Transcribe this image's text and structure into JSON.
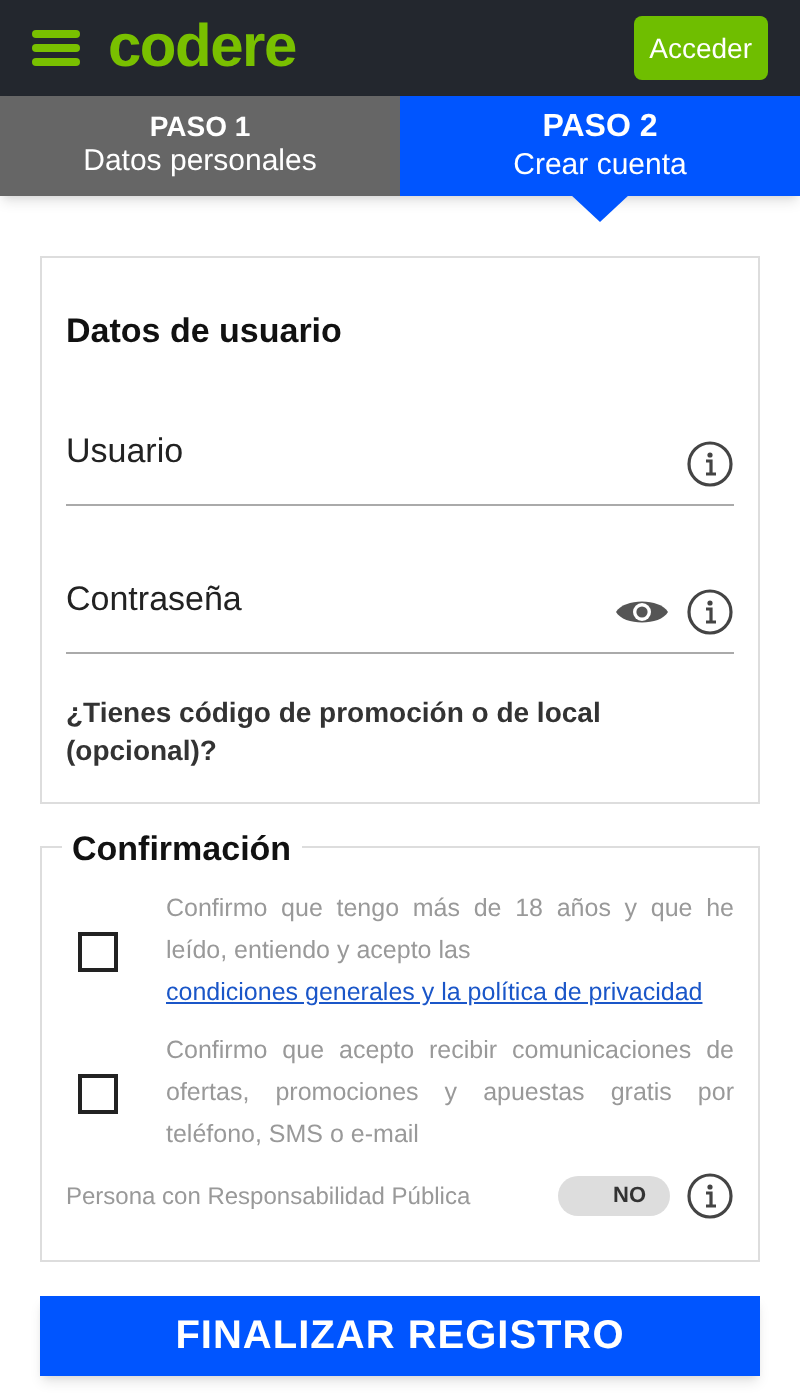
{
  "header": {
    "logo": "codere",
    "login_button": "Acceder"
  },
  "steps": [
    {
      "title": "PASO 1",
      "subtitle": "Datos personales",
      "selected": false
    },
    {
      "title": "PASO 2",
      "subtitle": "Crear cuenta",
      "selected": true
    }
  ],
  "user_data": {
    "title": "Datos de usuario",
    "fields": [
      {
        "kind": "text",
        "placeholder": "Usuario"
      },
      {
        "kind": "password",
        "placeholder": "Contraseña"
      }
    ],
    "promo_link": "¿Tienes código de promoción o de local (opcional)?"
  },
  "confirmation": {
    "title": "Confirmación",
    "checks": [
      {
        "text": "Confirmo que tengo más de 18 años y que he leído, entiendo y acepto las",
        "link": "condiciones generales y la política de privacidad",
        "checked": false
      },
      {
        "text": "Confirmo que acepto recibir comunicaciones de ofertas, promociones y apuestas gratis por teléfono, SMS o e-mail",
        "checked": false
      }
    ],
    "pep": {
      "label": "Persona con Responsabilidad Pública",
      "toggle_text": "NO",
      "on": false
    }
  },
  "submit_button": "FINALIZAR REGISTRO"
}
